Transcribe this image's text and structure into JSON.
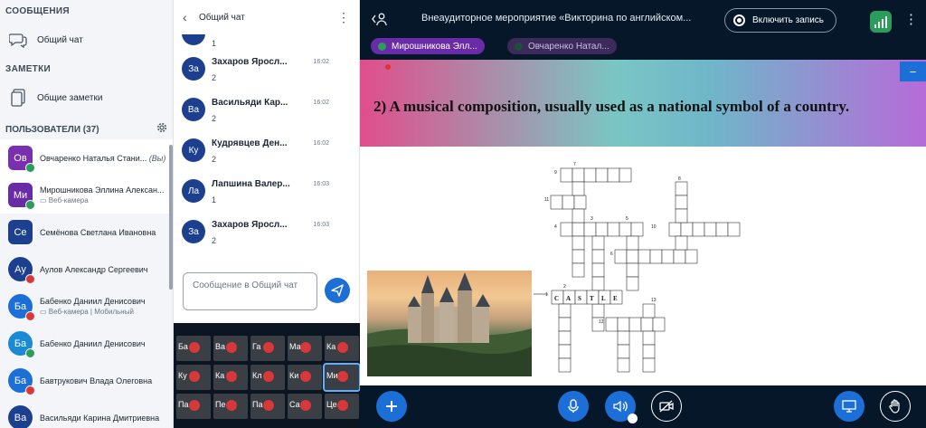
{
  "sidebar": {
    "messages_title": "СООБЩЕНИЯ",
    "public_chat": "Общий чат",
    "notes_title": "ЗАМЕТКИ",
    "shared_notes": "Общие заметки",
    "users_title": "ПОЛЬЗОВАТЕЛИ (37)",
    "users": [
      {
        "initials": "Ов",
        "name": "Овчаренко Наталья Стани...",
        "you": "(Вы)",
        "sub": "",
        "color": "#7a2fb0",
        "shape": "square",
        "badge": "#2a9d5a"
      },
      {
        "initials": "Ми",
        "name": "Мирошникова Эллина Алексан...",
        "you": "",
        "sub": "Веб-камера",
        "color": "#6a2ba8",
        "shape": "square",
        "badge": "#2a9d5a"
      },
      {
        "initials": "Се",
        "name": "Семёнова Светлана Ивановна",
        "you": "",
        "sub": "",
        "color": "#1d3f8f",
        "shape": "square",
        "badge": ""
      },
      {
        "initials": "Ау",
        "name": "Аулов Александр Сергеевич",
        "you": "",
        "sub": "",
        "color": "#1d3f8f",
        "shape": "round",
        "badge": "#d93838"
      },
      {
        "initials": "Ба",
        "name": "Бабенко Даниил Денисович",
        "you": "",
        "sub": "Веб-камера | Мобильный",
        "color": "#1b6fd6",
        "shape": "round",
        "badge": "#d93838"
      },
      {
        "initials": "Ба",
        "name": "Бабенко Даниил Денисович",
        "you": "",
        "sub": "",
        "color": "#1b8ad6",
        "shape": "round",
        "badge": "#2a9d5a"
      },
      {
        "initials": "Ба",
        "name": "Бавтрукович Влада Олеговна",
        "you": "",
        "sub": "",
        "color": "#1b6fd6",
        "shape": "round",
        "badge": "#d93838"
      },
      {
        "initials": "Ва",
        "name": "Васильяди Карина Дмитриевна",
        "you": "",
        "sub": "",
        "color": "#1d3f8f",
        "shape": "round",
        "badge": ""
      }
    ]
  },
  "chat": {
    "title": "Общий чат",
    "top_partial_text": "1",
    "messages": [
      {
        "initials": "За",
        "name": "Захаров Яросл...",
        "time": "16:02",
        "text": "2",
        "color": "#1d3f8f"
      },
      {
        "initials": "Ва",
        "name": "Васильяди Кар...",
        "time": "16:02",
        "text": "2",
        "color": "#1d3f8f"
      },
      {
        "initials": "Ку",
        "name": "Кудрявцев Ден...",
        "time": "16:02",
        "text": "2",
        "color": "#1d3f8f"
      },
      {
        "initials": "Ла",
        "name": "Лапшина Валер...",
        "time": "16:03",
        "text": "1",
        "color": "#1d3f8f"
      },
      {
        "initials": "За",
        "name": "Захаров Яросл...",
        "time": "16:03",
        "text": "2",
        "color": "#1d3f8f"
      }
    ],
    "input_placeholder": "Сообщение в Общий чат"
  },
  "tiles": [
    {
      "label": "Ба"
    },
    {
      "label": "Ва"
    },
    {
      "label": "Га"
    },
    {
      "label": "Ма"
    },
    {
      "label": "Ка"
    },
    {
      "label": "Ку"
    },
    {
      "label": "Ка"
    },
    {
      "label": "Кл"
    },
    {
      "label": "Ки"
    },
    {
      "label": "Ми"
    },
    {
      "label": "Па"
    },
    {
      "label": "Пе"
    },
    {
      "label": "Па"
    },
    {
      "label": "Са"
    },
    {
      "label": "Це"
    }
  ],
  "topbar": {
    "title": "Внеаудиторное мероприятие «Викторина по английском...",
    "record_label": "Включить запись",
    "talkers": [
      {
        "name": "Мирошникова Элл...",
        "active": true
      },
      {
        "name": "Овчаренко Натал...",
        "active": false
      }
    ]
  },
  "slide": {
    "question": "2) A musical composition, usually used as a national symbol of a country.",
    "crossword_word": "CASTLE",
    "clue_numbers": [
      "9",
      "7",
      "8",
      "11",
      "4",
      "3",
      "5",
      "10",
      "6",
      "1",
      "2",
      "13",
      "12"
    ]
  },
  "colors": {
    "accent": "#1b6fd6",
    "connection": "#2a9d5a",
    "muted": "#d93838"
  }
}
